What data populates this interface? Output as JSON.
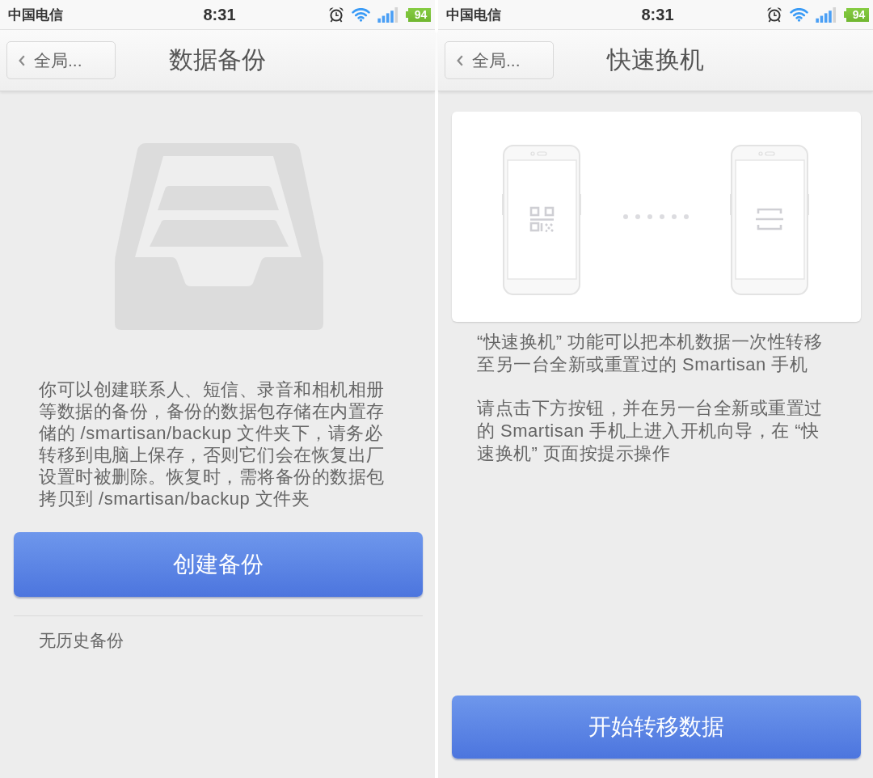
{
  "screens": [
    {
      "kind": "backup",
      "status_bar": {
        "carrier": "中国电信",
        "time": "8:31",
        "battery": "94"
      },
      "nav_bar": {
        "back_button": "全局...",
        "title": "数据备份"
      },
      "description": "你可以创建联系人、短信、录音和相机相册等数据的备份，备份的数据包存储在内置存储的 /smartisan/backup 文件夹下，请务必转移到电脑上保存，否则它们会在恢复出厂设置时被删除。恢复时，需将备份的数据包拷贝到 /smartisan/backup 文件夹",
      "button": "创建备份",
      "history": "无历史备份"
    },
    {
      "kind": "transfer",
      "status_bar": {
        "carrier": "中国电信",
        "time": "8:31",
        "battery": "94"
      },
      "nav_bar": {
        "back_button": "全局...",
        "title": "快速换机"
      },
      "paragraphs": [
        "“快速换机” 功能可以把本机数据一次性转移至另一台全新或重置过的 Smartisan 手机",
        "请点击下方按钮，并在另一台全新或重置过的 Smartisan 手机上进入开机向导，在 “快速换机” 页面按提示操作"
      ],
      "button": "开始转移数据"
    }
  ]
}
